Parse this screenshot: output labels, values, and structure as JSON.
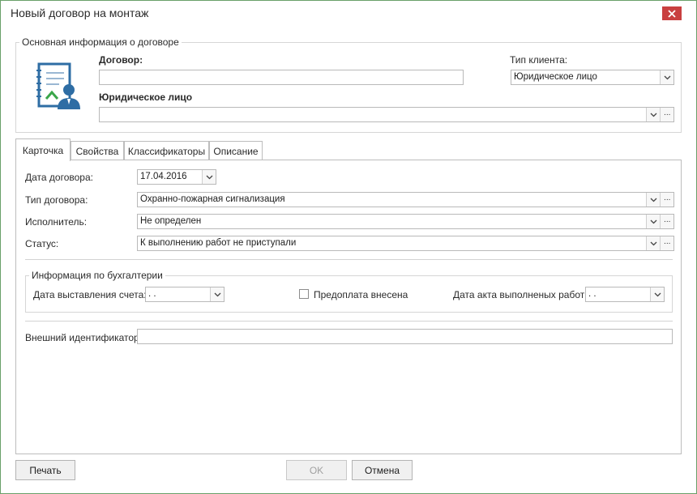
{
  "window": {
    "title": "Новый договор на монтаж"
  },
  "main_info": {
    "legend": "Основная информация о договоре",
    "contract_label": "Договор:",
    "contract_value": "",
    "client_type_label": "Тип клиента:",
    "client_type_value": "Юридическое лицо",
    "entity_label": "Юридическое лицо",
    "entity_value": ""
  },
  "tabs": [
    "Карточка",
    "Свойства",
    "Классификаторы",
    "Описание"
  ],
  "card": {
    "contract_date_label": "Дата договора:",
    "contract_date_value": "17.04.2016",
    "contract_type_label": "Тип договора:",
    "contract_type_value": "Охранно-пожарная сигнализация",
    "executor_label": "Исполнитель:",
    "executor_value": "Не определен",
    "status_label": "Статус:",
    "status_value": "К выполнению работ не приступали",
    "accounting": {
      "legend": "Информация по бухгалтерии",
      "invoice_date_label": "Дата выставления счета:",
      "invoice_date_value": " .  .",
      "prepayment_label": "Предоплата внесена",
      "act_date_label": "Дата акта выполненых работ:",
      "act_date_value": " .  ."
    },
    "external_id_label": "Внешний идентификатор:",
    "external_id_value": ""
  },
  "buttons": {
    "print": "Печать",
    "ok": "OK",
    "cancel": "Отмена"
  },
  "icons": {
    "close": "close-icon",
    "dropdown": "chevron-down-icon",
    "ellipsis": "ellipsis-icon",
    "contract": "contract-user-icon"
  },
  "colors": {
    "close_bg": "#c94040",
    "window_border": "#6aa06a",
    "icon_blue": "#2e6da4",
    "icon_green": "#3aa64a"
  }
}
